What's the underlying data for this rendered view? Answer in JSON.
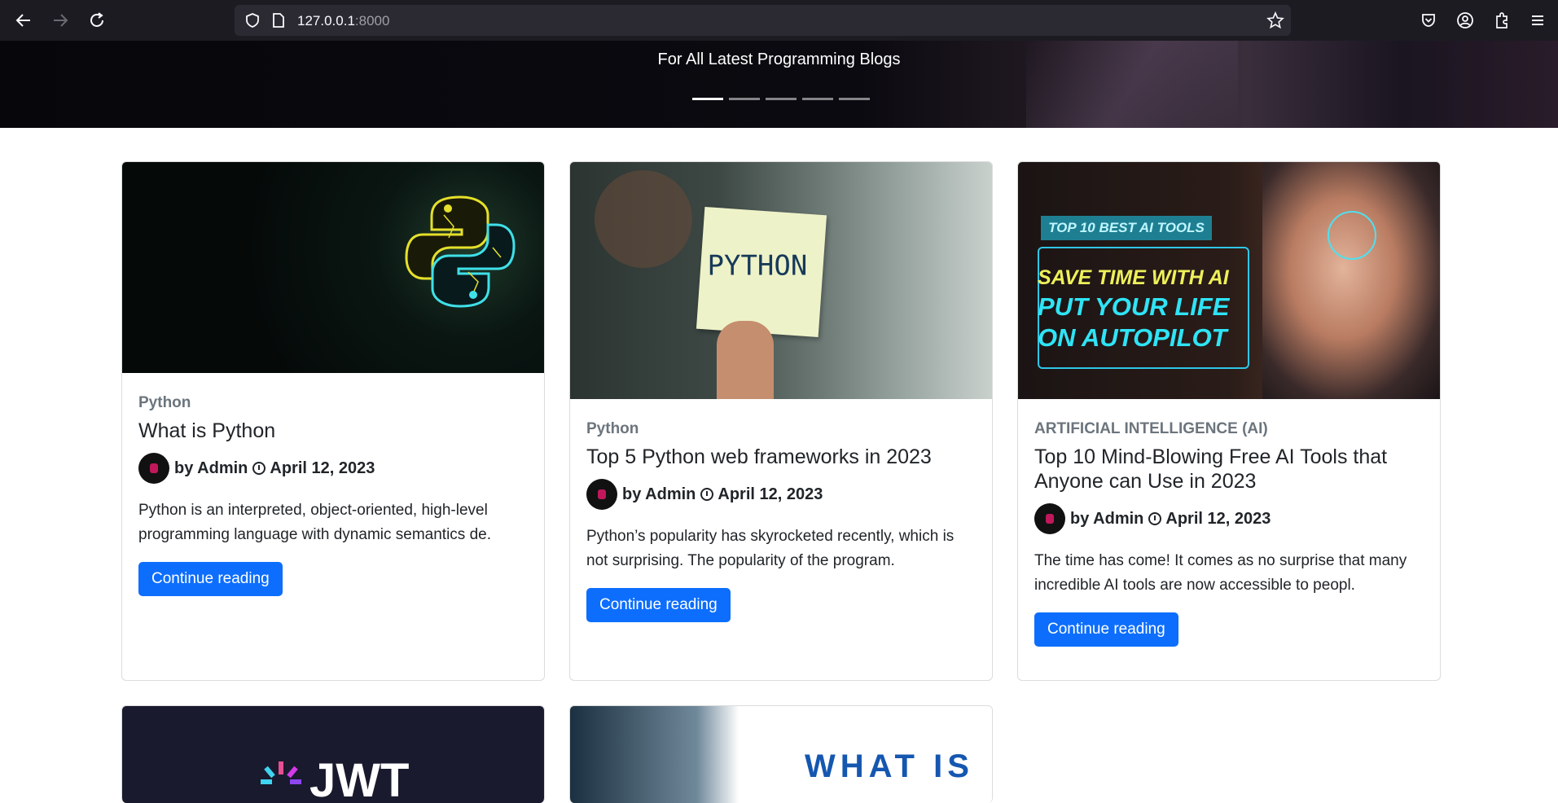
{
  "browser": {
    "url_host": "127.0.0.1",
    "url_port": ":8000"
  },
  "hero": {
    "subtitle": "For All Latest Programming Blogs",
    "slides": 5,
    "active_slide": 1
  },
  "posts": [
    {
      "category": "Python",
      "title": "What is Python",
      "author": "by Admin",
      "date": "April 12, 2023",
      "excerpt": "Python is an interpreted, object-oriented, high-level programming language with dynamic semantics de.",
      "button": "Continue reading"
    },
    {
      "category": "Python",
      "title": "Top 5 Python web frameworks in 2023",
      "author": "by Admin",
      "date": "April 12, 2023",
      "excerpt": "Python’s popularity has skyrocketed recently, which is not surprising. The popularity of the program.",
      "button": "Continue reading",
      "image_text": "PYTHON"
    },
    {
      "category": "ARTIFICIAL INTELLIGENCE (AI)",
      "title": "Top 10 Mind-Blowing Free AI Tools that Anyone can Use in 2023",
      "author": "by Admin",
      "date": "April 12, 2023",
      "excerpt": "The time has come! It comes as no surprise that many incredible AI tools are now accessible to peopl.",
      "button": "Continue reading",
      "image_text": {
        "tag": "TOP 10 BEST AI TOOLS",
        "line1": "SAVE TIME WITH AI",
        "line2": "PUT YOUR LIFE",
        "line3": "ON AUTOPILOT"
      }
    }
  ],
  "partial_cards": [
    {
      "image_text": "JWT"
    },
    {
      "image_text": "WHAT IS"
    }
  ],
  "colors": {
    "primary": "#0d6efd",
    "muted": "#6c757d",
    "text": "#212529"
  }
}
